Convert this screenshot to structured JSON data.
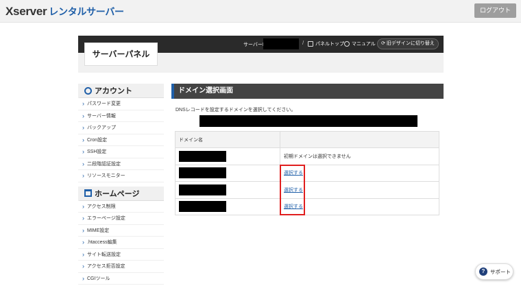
{
  "header": {
    "logo_main": "Xserver",
    "logo_sub": "レンタルサーバー",
    "logout_label": "ログアウト"
  },
  "panel": {
    "title": "サーバーパネル",
    "server_id_label": "サーバーID",
    "separator": "/",
    "panel_top_label": "パネルトップ",
    "manual_label": "マニュアル",
    "old_design_label": "旧デザインに切り替え"
  },
  "sidebar": {
    "account_heading": "アカウント",
    "account_items": [
      {
        "label": "パスワード変更"
      },
      {
        "label": "サーバー情報"
      },
      {
        "label": "バックアップ"
      },
      {
        "label": "Cron設定"
      },
      {
        "label": "SSH設定"
      },
      {
        "label": "二段階認証設定"
      },
      {
        "label": "リソースモニター"
      }
    ],
    "homepage_heading": "ホームページ",
    "homepage_items": [
      {
        "label": "アクセス制限"
      },
      {
        "label": "エラーページ設定"
      },
      {
        "label": "MIME設定"
      },
      {
        "label": ".htaccess編集"
      },
      {
        "label": "サイト転送設定"
      },
      {
        "label": "アクセス拒否設定"
      },
      {
        "label": "CGIツール"
      }
    ]
  },
  "main": {
    "title": "ドメイン選択画面",
    "description": "DNSレコードを設定するドメインを選択してください。",
    "table": {
      "header_domain": "ドメイン名",
      "header_action": "",
      "rows": [
        {
          "action": "初期ドメインは選択できません",
          "link": false
        },
        {
          "action": "選択する",
          "link": true
        },
        {
          "action": "選択する",
          "link": true
        },
        {
          "action": "選択する",
          "link": true
        }
      ]
    }
  },
  "support": {
    "label": "サポート",
    "icon_glyph": "?"
  },
  "colors": {
    "brand_blue": "#1f5fa8",
    "highlight_red": "#e01e1e"
  }
}
